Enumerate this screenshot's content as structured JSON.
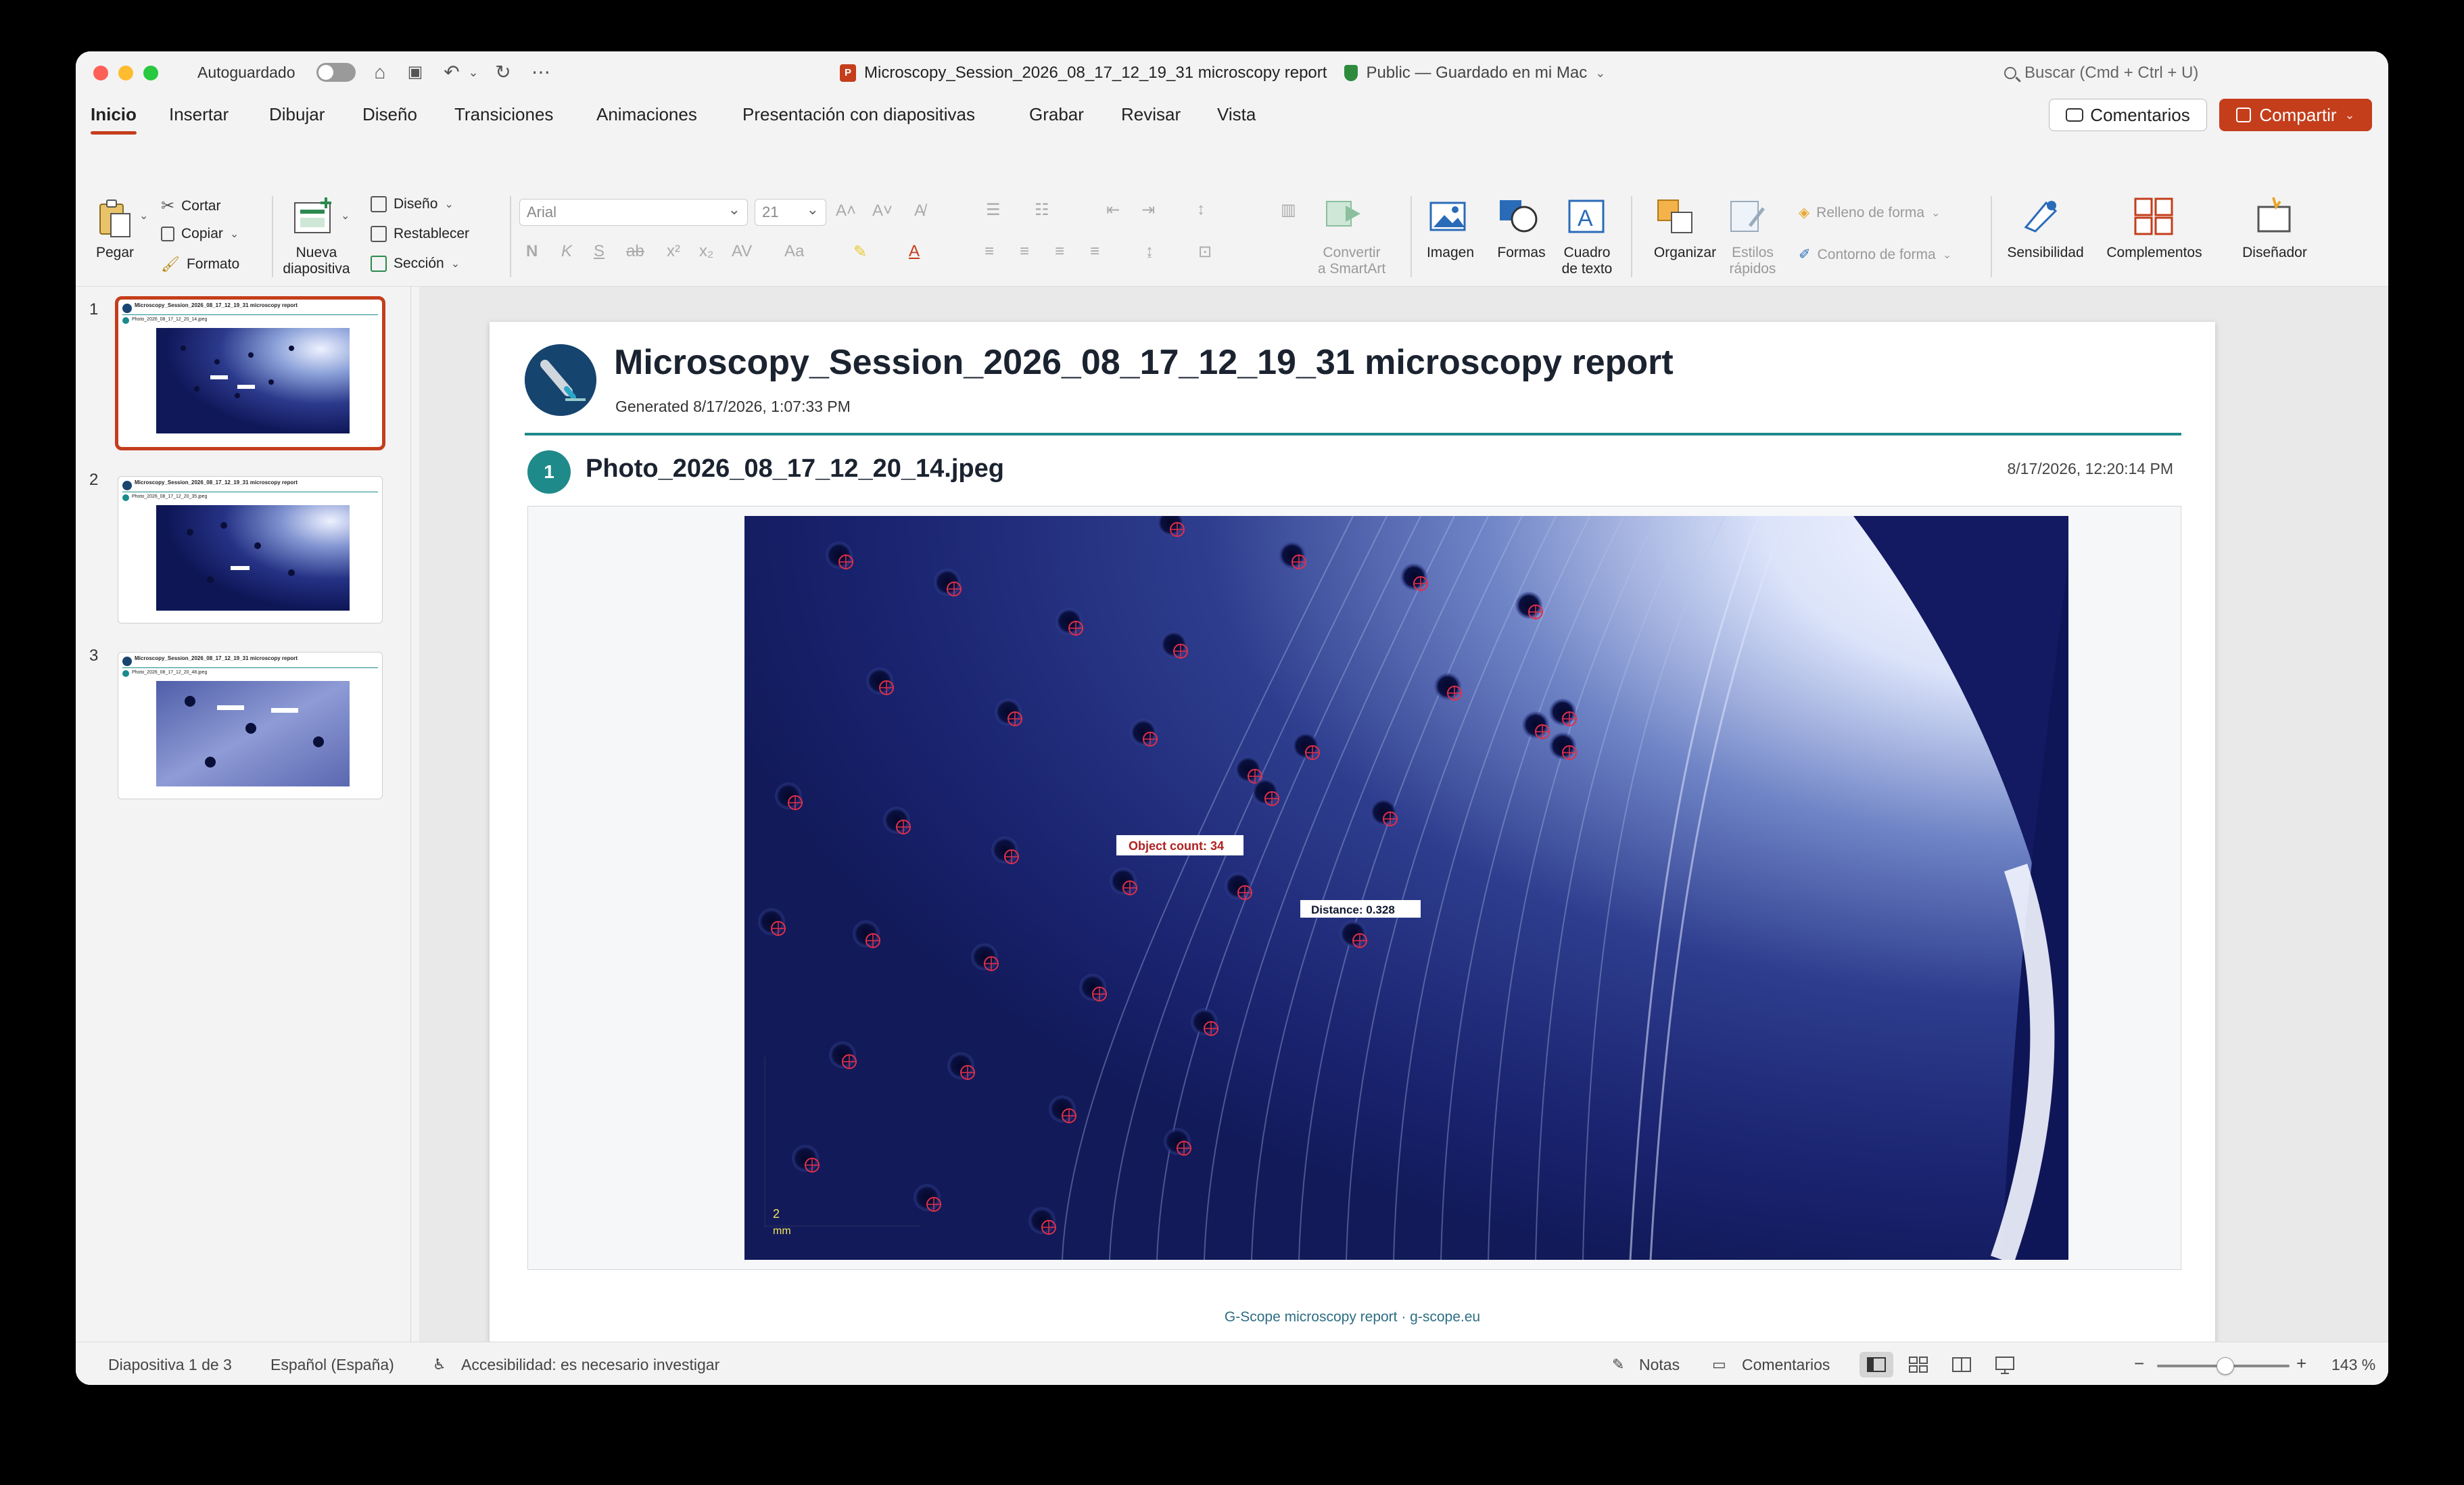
{
  "titlebar": {
    "autosave_label": "Autoguardado",
    "document_title": "Microscopy_Session_2026_08_17_12_19_31 microscopy report",
    "document_status": "Public — Guardado en mi Mac",
    "search_placeholder": "Buscar (Cmd + Ctrl + U)"
  },
  "tabs": [
    "Inicio",
    "Insertar",
    "Dibujar",
    "Diseño",
    "Transiciones",
    "Animaciones",
    "Presentación con diapositivas",
    "Grabar",
    "Revisar",
    "Vista"
  ],
  "actions": {
    "comments": "Comentarios",
    "share": "Compartir"
  },
  "ribbon": {
    "paste": "Pegar",
    "cut": "Cortar",
    "copy": "Copiar",
    "format_painter": "Formato",
    "new_slide": [
      "Nueva",
      "diapositiva"
    ],
    "layout": "Diseño",
    "reset": "Restablecer",
    "section": "Sección",
    "font_name": "Arial",
    "font_size": "21",
    "convert_smartart": [
      "Convertir",
      "a SmartArt"
    ],
    "image": "Imagen",
    "shapes": "Formas",
    "textbox": [
      "Cuadro",
      "de texto"
    ],
    "arrange": "Organizar",
    "quick_styles": [
      "Estilos",
      "rápidos"
    ],
    "shape_fill": "Relleno de forma",
    "shape_outline": "Contorno de forma",
    "sensitivity": "Sensibilidad",
    "addins": "Complementos",
    "designer": "Diseñador"
  },
  "thumbnails": [
    {
      "number": "1",
      "title": "Microscopy_Session_2026_08_17_12_19_31 microscopy report",
      "photo": "Photo_2026_08_17_12_20_14.jpeg",
      "active": true
    },
    {
      "number": "2",
      "title": "Microscopy_Session_2026_08_17_12_19_31 microscopy report",
      "photo": "Photo_2026_08_17_12_20_35.jpeg",
      "active": false
    },
    {
      "number": "3",
      "title": "Microscopy_Session_2026_08_17_12_19_31 microscopy report",
      "photo": "Photo_2026_08_17_12_20_48.jpeg",
      "active": false
    }
  ],
  "slide": {
    "title": "Microscopy_Session_2026_08_17_12_19_31 microscopy report",
    "generated": "Generated 8/17/2026, 1:07:33 PM",
    "photo_index": "1",
    "photo_name": "Photo_2026_08_17_12_20_14.jpeg",
    "photo_timestamp": "8/17/2026, 12:20:14 PM",
    "object_count": "Object count: 34",
    "distance": "Distance: 0.328",
    "scale_value": "2",
    "scale_unit": "mm",
    "footer": "G-Scope microscopy report · g-scope.eu"
  },
  "statusbar": {
    "slide_position": "Diapositiva 1 de 3",
    "language": "Español (España)",
    "accessibility": "Accesibilidad: es necesario investigar",
    "notes": "Notas",
    "comments": "Comentarios",
    "zoom": "143 %"
  },
  "colors": {
    "accent": "#c43e1c",
    "teal": "#1f8a8a",
    "marker": "#e0304a"
  }
}
